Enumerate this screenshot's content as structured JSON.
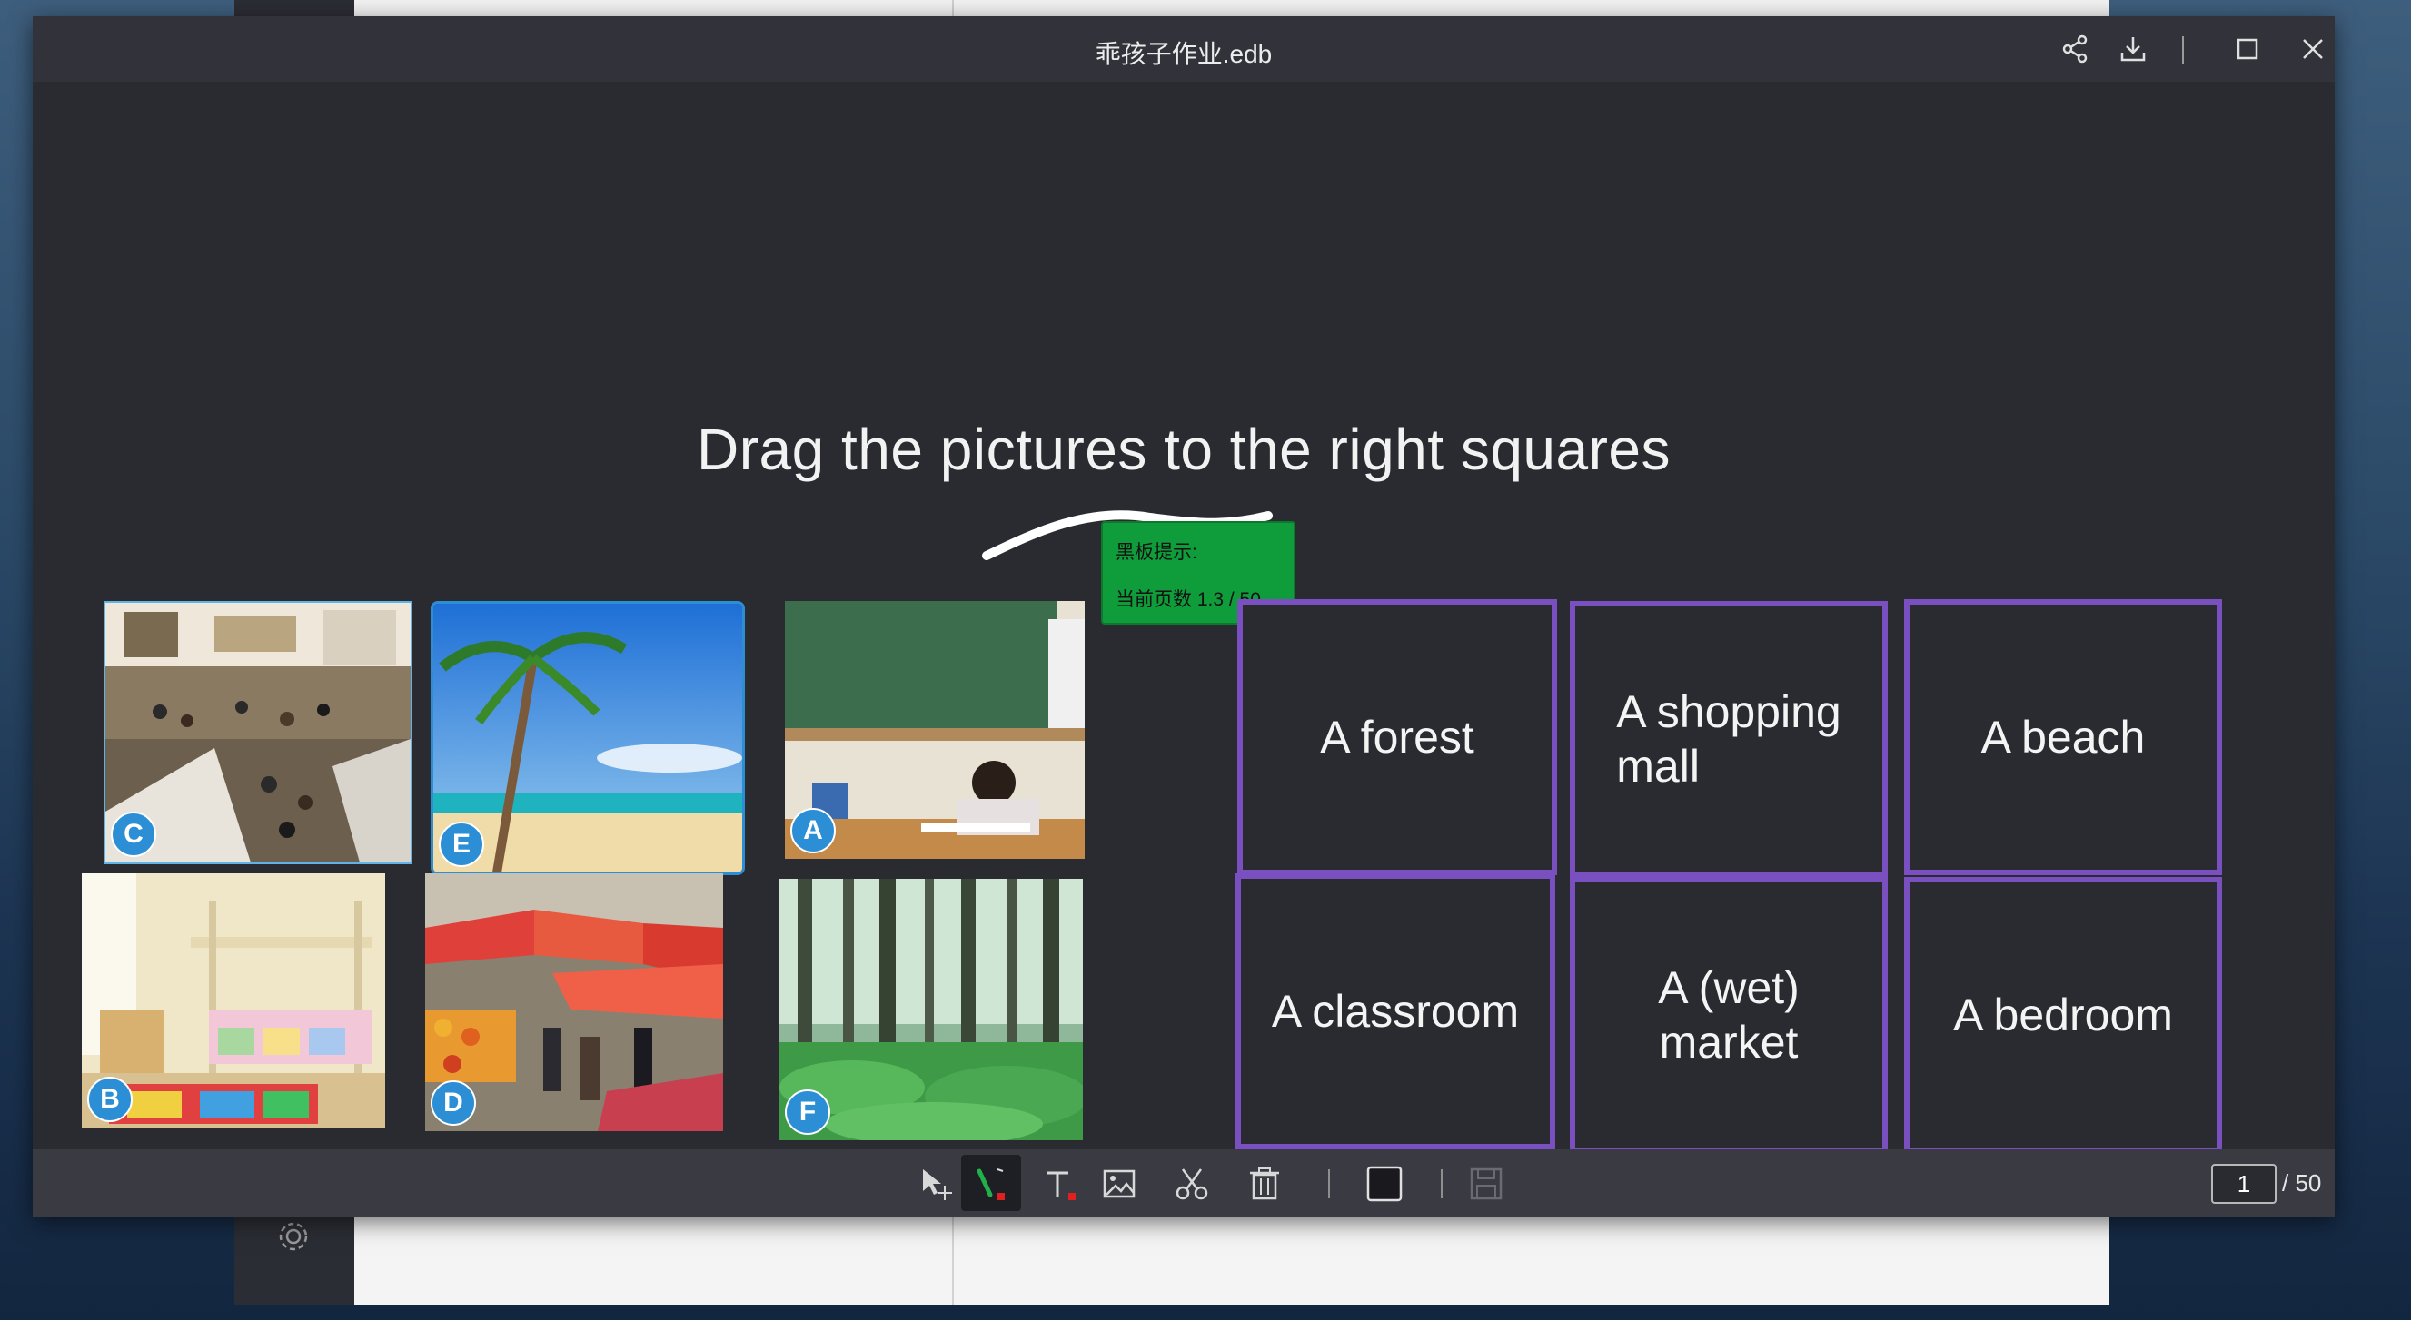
{
  "window": {
    "title": "乖孩子作业.edb"
  },
  "board": {
    "heading": "Drag the pictures to the right squares",
    "tooltip": {
      "line1": "黑板提示:",
      "line2": "当前页数 1.3 / 50"
    },
    "pictures": [
      {
        "letter": "C",
        "icon": "shopping-mall-photo"
      },
      {
        "letter": "E",
        "icon": "beach-photo"
      },
      {
        "letter": "A",
        "icon": "classroom-photo"
      },
      {
        "letter": "B",
        "icon": "bedroom-photo"
      },
      {
        "letter": "D",
        "icon": "wet-market-photo"
      },
      {
        "letter": "F",
        "icon": "forest-photo"
      }
    ],
    "boxes": [
      {
        "line1": "A forest",
        "line2": ""
      },
      {
        "line1": "A shopping",
        "line2": "mall"
      },
      {
        "line1": "A beach",
        "line2": ""
      },
      {
        "line1": "A classroom",
        "line2": ""
      },
      {
        "line1": "A (wet)",
        "line2": "market"
      },
      {
        "line1": "A bedroom",
        "line2": ""
      }
    ]
  },
  "toolbar": {
    "tools": [
      "select-move-icon",
      "pen-icon",
      "text-icon",
      "image-icon",
      "scissors-icon",
      "trash-icon",
      "color-swatch-icon",
      "save-icon"
    ],
    "page_current": "1",
    "page_total": "/ 50"
  },
  "colors": {
    "box_border": "#7a4fc0",
    "tooltip_bg": "#0f9d3b",
    "board_bg": "#2a2b30",
    "badge_bg": "#2c8fd6",
    "pen_accent": "#e02020"
  }
}
